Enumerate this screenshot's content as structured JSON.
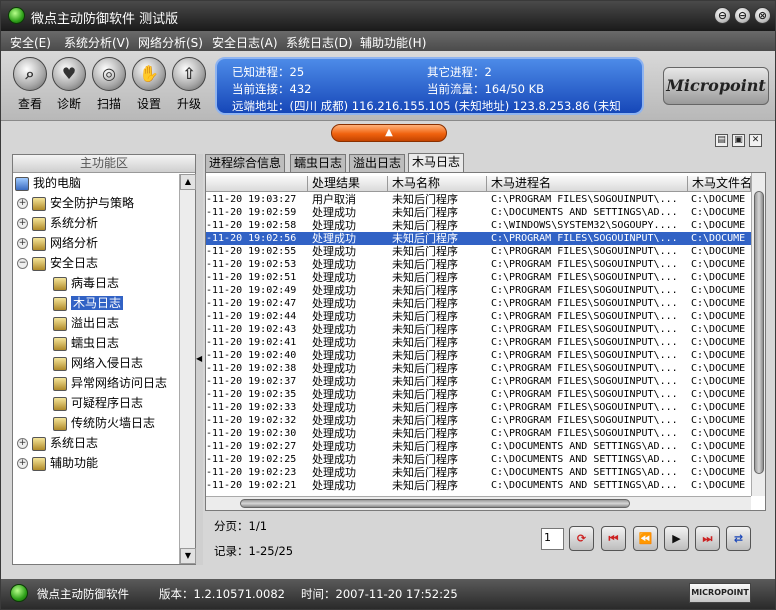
{
  "window": {
    "title": "微点主动防御软件 测试版",
    "controls": [
      "⊖",
      "⊖",
      "⊗"
    ]
  },
  "menu": [
    "安全(E)",
    "系统分析(V)",
    "网络分析(S)",
    "安全日志(A)",
    "系统日志(D)",
    "辅助功能(H)"
  ],
  "toolbar": {
    "buttons": [
      {
        "label": "查看",
        "icon": "magnifier-icon"
      },
      {
        "label": "诊断",
        "icon": "heart-check-icon"
      },
      {
        "label": "扫描",
        "icon": "scan-icon"
      },
      {
        "label": "设置",
        "icon": "hand-settings-icon"
      },
      {
        "label": "升级",
        "icon": "upgrade-arrow-icon"
      }
    ],
    "info": {
      "known_process": "已知进程：25",
      "other_process": "其它进程：2",
      "current_conn": "当前连接：432",
      "current_flow": "当前流量：164/50 KB",
      "remote_addr": "远端地址：(四川 成都)  116.216.155.105 (未知地址)  123.8.253.86 (未知"
    },
    "logo": "Micropoint"
  },
  "left_panel": {
    "header": "主功能区",
    "tree": [
      {
        "label": "我的电脑",
        "level": 0,
        "expander": ""
      },
      {
        "label": "安全防护与策略",
        "level": 1,
        "expander": "+"
      },
      {
        "label": "系统分析",
        "level": 1,
        "expander": "+"
      },
      {
        "label": "网络分析",
        "level": 1,
        "expander": "+"
      },
      {
        "label": "安全日志",
        "level": 1,
        "expander": "−"
      },
      {
        "label": "病毒日志",
        "level": 2,
        "expander": ""
      },
      {
        "label": "木马日志",
        "level": 2,
        "expander": "",
        "selected": true
      },
      {
        "label": "溢出日志",
        "level": 2,
        "expander": ""
      },
      {
        "label": "蠕虫日志",
        "level": 2,
        "expander": ""
      },
      {
        "label": "网络入侵日志",
        "level": 2,
        "expander": ""
      },
      {
        "label": "异常网络访问日志",
        "level": 2,
        "expander": ""
      },
      {
        "label": "可疑程序日志",
        "level": 2,
        "expander": ""
      },
      {
        "label": "传统防火墙日志",
        "level": 2,
        "expander": ""
      },
      {
        "label": "系统日志",
        "level": 1,
        "expander": "+"
      },
      {
        "label": "辅助功能",
        "level": 1,
        "expander": "+"
      }
    ]
  },
  "tabs": [
    {
      "label": "进程综合信息"
    },
    {
      "label": "蠕虫日志"
    },
    {
      "label": "溢出日志"
    },
    {
      "label": "木马日志",
      "active": true
    }
  ],
  "table": {
    "columns": [
      "",
      "处理结果",
      "木马名称",
      "木马进程名",
      "木马文件名"
    ],
    "rows": [
      [
        "-11-20 19:03:27",
        "用户取消",
        "未知后门程序",
        "C:\\PROGRAM FILES\\SOGOUINPUT\\...",
        "C:\\DOCUME"
      ],
      [
        "-11-20 19:02:59",
        "处理成功",
        "未知后门程序",
        "C:\\DOCUMENTS AND SETTINGS\\AD...",
        "C:\\DOCUME"
      ],
      [
        "-11-20 19:02:58",
        "处理成功",
        "未知后门程序",
        "C:\\WINDOWS\\SYSTEM32\\SOGOUPY....",
        "C:\\DOCUME"
      ],
      [
        "-11-20 19:02:56",
        "处理成功",
        "未知后门程序",
        "C:\\PROGRAM FILES\\SOGOUINPUT\\...",
        "C:\\DOCUME"
      ],
      [
        "-11-20 19:02:55",
        "处理成功",
        "未知后门程序",
        "C:\\PROGRAM FILES\\SOGOUINPUT\\...",
        "C:\\DOCUME"
      ],
      [
        "-11-20 19:02:53",
        "处理成功",
        "未知后门程序",
        "C:\\PROGRAM FILES\\SOGOUINPUT\\...",
        "C:\\DOCUME"
      ],
      [
        "-11-20 19:02:51",
        "处理成功",
        "未知后门程序",
        "C:\\PROGRAM FILES\\SOGOUINPUT\\...",
        "C:\\DOCUME"
      ],
      [
        "-11-20 19:02:49",
        "处理成功",
        "未知后门程序",
        "C:\\PROGRAM FILES\\SOGOUINPUT\\...",
        "C:\\DOCUME"
      ],
      [
        "-11-20 19:02:47",
        "处理成功",
        "未知后门程序",
        "C:\\PROGRAM FILES\\SOGOUINPUT\\...",
        "C:\\DOCUME"
      ],
      [
        "-11-20 19:02:44",
        "处理成功",
        "未知后门程序",
        "C:\\PROGRAM FILES\\SOGOUINPUT\\...",
        "C:\\DOCUME"
      ],
      [
        "-11-20 19:02:43",
        "处理成功",
        "未知后门程序",
        "C:\\PROGRAM FILES\\SOGOUINPUT\\...",
        "C:\\DOCUME"
      ],
      [
        "-11-20 19:02:41",
        "处理成功",
        "未知后门程序",
        "C:\\PROGRAM FILES\\SOGOUINPUT\\...",
        "C:\\DOCUME"
      ],
      [
        "-11-20 19:02:40",
        "处理成功",
        "未知后门程序",
        "C:\\PROGRAM FILES\\SOGOUINPUT\\...",
        "C:\\DOCUME"
      ],
      [
        "-11-20 19:02:38",
        "处理成功",
        "未知后门程序",
        "C:\\PROGRAM FILES\\SOGOUINPUT\\...",
        "C:\\DOCUME"
      ],
      [
        "-11-20 19:02:37",
        "处理成功",
        "未知后门程序",
        "C:\\PROGRAM FILES\\SOGOUINPUT\\...",
        "C:\\DOCUME"
      ],
      [
        "-11-20 19:02:35",
        "处理成功",
        "未知后门程序",
        "C:\\PROGRAM FILES\\SOGOUINPUT\\...",
        "C:\\DOCUME"
      ],
      [
        "-11-20 19:02:33",
        "处理成功",
        "未知后门程序",
        "C:\\PROGRAM FILES\\SOGOUINPUT\\...",
        "C:\\DOCUME"
      ],
      [
        "-11-20 19:02:32",
        "处理成功",
        "未知后门程序",
        "C:\\PROGRAM FILES\\SOGOUINPUT\\...",
        "C:\\DOCUME"
      ],
      [
        "-11-20 19:02:30",
        "处理成功",
        "未知后门程序",
        "C:\\PROGRAM FILES\\SOGOUINPUT\\...",
        "C:\\DOCUME"
      ],
      [
        "-11-20 19:02:27",
        "处理成功",
        "未知后门程序",
        "C:\\DOCUMENTS AND SETTINGS\\AD...",
        "C:\\DOCUME"
      ],
      [
        "-11-20 19:02:25",
        "处理成功",
        "未知后门程序",
        "C:\\DOCUMENTS AND SETTINGS\\AD...",
        "C:\\DOCUME"
      ],
      [
        "-11-20 19:02:23",
        "处理成功",
        "未知后门程序",
        "C:\\DOCUMENTS AND SETTINGS\\AD...",
        "C:\\DOCUME"
      ],
      [
        "-11-20 19:02:21",
        "处理成功",
        "未知后门程序",
        "C:\\DOCUMENTS AND SETTINGS\\AD...",
        "C:\\DOCUME"
      ]
    ],
    "selected_row": 3
  },
  "paging": {
    "page_text": "分页：1/1",
    "record_text": "记录：1-25/25",
    "page_input": "1"
  },
  "status": {
    "app": "微点主动防御软件",
    "version": "版本：1.2.10571.0082",
    "time": "时间：2007-11-20 17:52:25",
    "badge": "MICROPOINT"
  }
}
